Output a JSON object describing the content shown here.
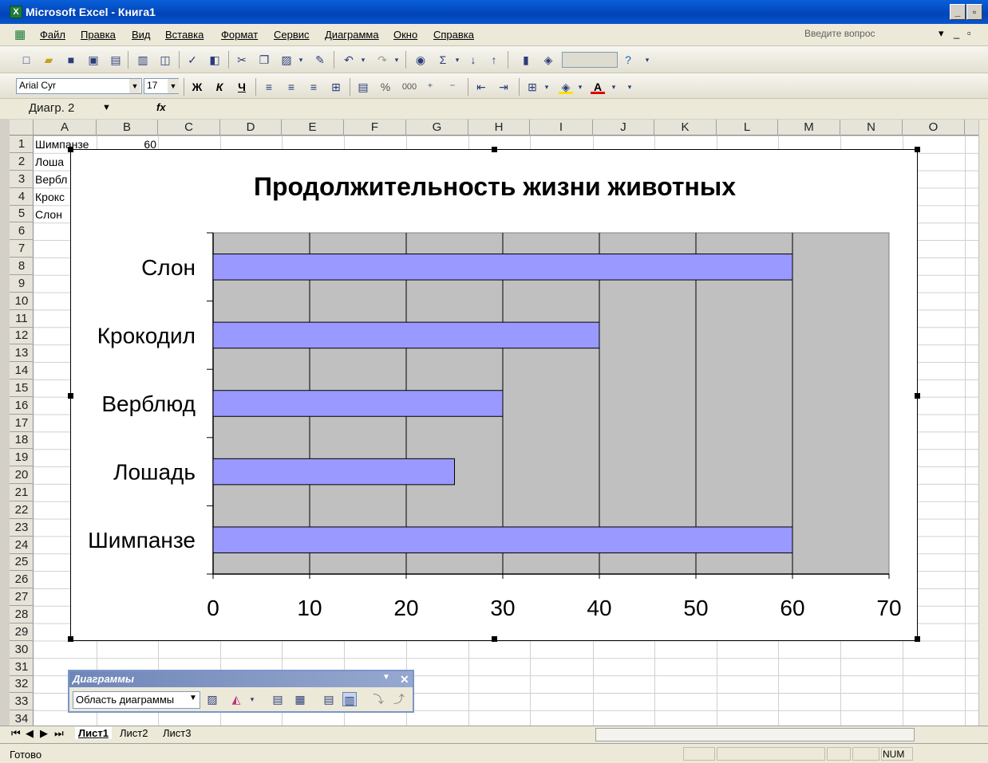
{
  "window": {
    "title": "Microsoft Excel - Книга1"
  },
  "menu": [
    "Файл",
    "Правка",
    "Вид",
    "Вставка",
    "Формат",
    "Сервис",
    "Диаграмма",
    "Окно",
    "Справка"
  ],
  "ask_placeholder": "Введите вопрос",
  "font": {
    "name": "Arial Cyr",
    "size": "17"
  },
  "format_buttons": {
    "bold": "Ж",
    "italic": "К",
    "underline": "Ч"
  },
  "number_format": {
    "percent": "%",
    "thousands": "000"
  },
  "namebox": "Диагр. 2",
  "fx": "fx",
  "columns": [
    "A",
    "B",
    "C",
    "D",
    "E",
    "F",
    "G",
    "H",
    "I",
    "J",
    "K",
    "L",
    "M",
    "N",
    "O"
  ],
  "rows": [
    "1",
    "2",
    "3",
    "4",
    "5",
    "6",
    "7",
    "8",
    "9",
    "10",
    "11",
    "12",
    "13",
    "14",
    "15",
    "16",
    "17",
    "18",
    "19",
    "20",
    "21",
    "22",
    "23",
    "24",
    "25",
    "26",
    "27",
    "28",
    "29",
    "30",
    "31",
    "32",
    "33",
    "34"
  ],
  "cells": {
    "a1": "Шимпанзе",
    "b1": "60",
    "a2": "Лоша",
    "a3": "Вербл",
    "a4": "Крокс",
    "a5": "Слон"
  },
  "chart_data": {
    "type": "bar",
    "orientation": "horizontal",
    "title": "Продолжительность жизни животных",
    "categories": [
      "Шимпанзе",
      "Лошадь",
      "Верблюд",
      "Крокодил",
      "Слон"
    ],
    "values": [
      60,
      25,
      30,
      40,
      60
    ],
    "xlim": [
      0,
      70
    ],
    "x_ticks": [
      "0",
      "10",
      "20",
      "30",
      "40",
      "50",
      "60",
      "70"
    ],
    "grid": true,
    "bar_color": "#9999ff",
    "plot_background": "#c0c0c0"
  },
  "sheets": [
    "Лист1",
    "Лист2",
    "Лист3"
  ],
  "status": {
    "ready": "Готово",
    "num": "NUM"
  },
  "chart_toolbar": {
    "title": "Диаграммы",
    "area": "Область диаграммы"
  }
}
